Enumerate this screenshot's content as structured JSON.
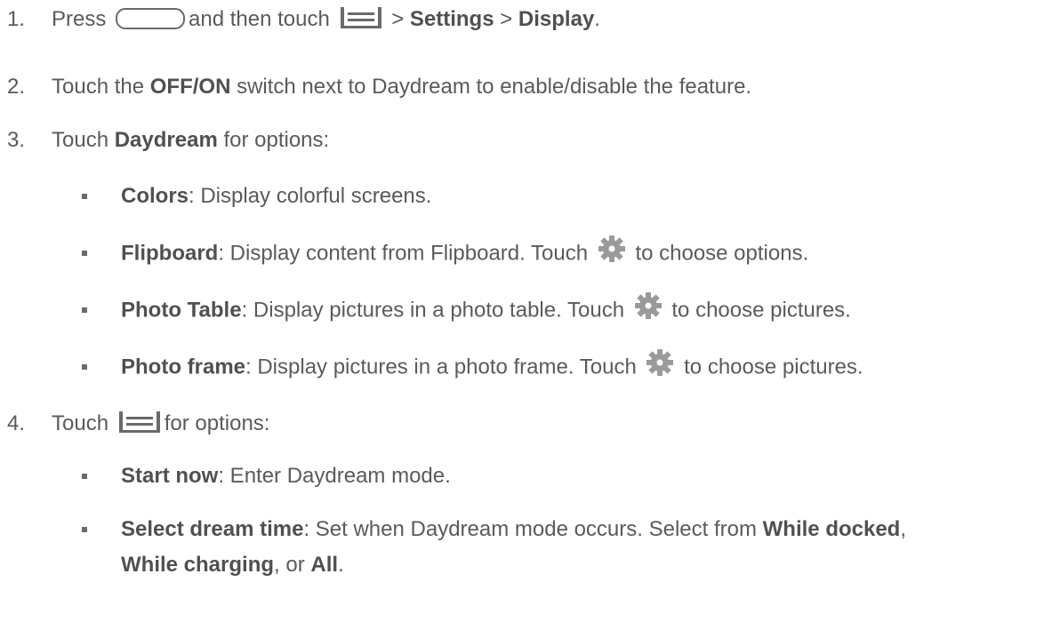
{
  "steps": [
    {
      "number": "1.",
      "press": "Press",
      "then_touch": "and then touch",
      "sep1": ">",
      "settings": "Settings",
      "sep2": ">",
      "display": "Display",
      "end": "."
    },
    {
      "number": "2.",
      "pre": "Touch the",
      "bold": "OFF/ON",
      "post": "switch next to Daydream to enable/disable the feature."
    },
    {
      "number": "3.",
      "pre": "Touch",
      "bold": "Daydream",
      "post": "for options:",
      "items": [
        {
          "bold": "Colors",
          "text": ": Display colorful screens."
        },
        {
          "bold": "Flipboard",
          "text": ": Display content from Flipboard. Touch",
          "after": "to choose options."
        },
        {
          "bold": "Photo Table",
          "text": ": Display pictures in a photo table. Touch",
          "after": "to choose pictures."
        },
        {
          "bold": "Photo frame",
          "text": ": Display pictures in a photo frame. Touch",
          "after": "to choose pictures."
        }
      ]
    },
    {
      "number": "4.",
      "pre": "Touch",
      "post": "for options:",
      "items": [
        {
          "bold": "Start now",
          "text": ": Enter Daydream mode."
        },
        {
          "bold": "Select dream time",
          "text": ": Set when Daydream mode occurs. Select from",
          "opt1": "While docked",
          "comma": ",",
          "opt2": "While charging",
          "or": ", or",
          "opt3": "All",
          "end": "."
        }
      ]
    }
  ],
  "icons": {
    "home_button": "home-key-icon",
    "menu": "menu-key-icon",
    "settings": "gear-icon"
  },
  "colors": {
    "text": "#5a5a5a",
    "icon": "#9a9a9a"
  }
}
